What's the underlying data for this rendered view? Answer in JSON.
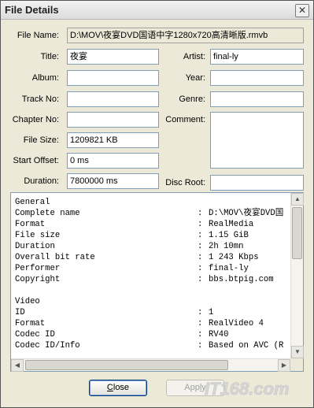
{
  "window": {
    "title": "File Details",
    "close_glyph": "✕"
  },
  "fields": {
    "file_name": {
      "label": "File Name:",
      "value": "D:\\MOV\\夜宴DVD国语中字1280x720高清晰版.rmvb"
    },
    "title": {
      "label": "Title:",
      "value": "夜宴"
    },
    "artist": {
      "label": "Artist:",
      "value": "final-ly"
    },
    "album": {
      "label": "Album:",
      "value": ""
    },
    "year": {
      "label": "Year:",
      "value": ""
    },
    "track_no": {
      "label": "Track No:",
      "value": ""
    },
    "genre": {
      "label": "Genre:",
      "value": ""
    },
    "chapter_no": {
      "label": "Chapter No:",
      "value": ""
    },
    "comment": {
      "label": "Comment:",
      "value": ""
    },
    "file_size": {
      "label": "File Size:",
      "value": "1209821 KB"
    },
    "start_offset": {
      "label": "Start Offset:",
      "value": "0 ms"
    },
    "duration": {
      "label": "Duration:",
      "value": "7800000 ms"
    },
    "disc_root": {
      "label": "Disc Root:",
      "value": ""
    }
  },
  "info_rows": [
    {
      "key": "General",
      "colon": "",
      "val": ""
    },
    {
      "key": "Complete name",
      "colon": ":",
      "val": "D:\\MOV\\夜宴DVD国"
    },
    {
      "key": "Format",
      "colon": ":",
      "val": "RealMedia"
    },
    {
      "key": "File size",
      "colon": ":",
      "val": "1.15 GiB"
    },
    {
      "key": "Duration",
      "colon": ":",
      "val": "2h 10mn"
    },
    {
      "key": "Overall bit rate",
      "colon": ":",
      "val": "1 243 Kbps"
    },
    {
      "key": "Performer",
      "colon": ":",
      "val": "final-ly"
    },
    {
      "key": "Copyright",
      "colon": ":",
      "val": "bbs.btpig.com"
    },
    {
      "key": "",
      "colon": "",
      "val": ""
    },
    {
      "key": "Video",
      "colon": "",
      "val": ""
    },
    {
      "key": "ID",
      "colon": ":",
      "val": "1"
    },
    {
      "key": "Format",
      "colon": ":",
      "val": "RealVideo 4"
    },
    {
      "key": "Codec ID",
      "colon": ":",
      "val": "RV40"
    },
    {
      "key": "Codec ID/Info",
      "colon": ":",
      "val": "Based on AVC (R"
    }
  ],
  "scroll": {
    "up": "▲",
    "down": "▼",
    "left": "◀",
    "right": "▶"
  },
  "buttons": {
    "close": {
      "label_u": "C",
      "label_rest": "lose"
    },
    "apply": {
      "label_pre": "App",
      "label_u": "l",
      "label_rest": "y"
    }
  },
  "watermark": "IT168.com"
}
